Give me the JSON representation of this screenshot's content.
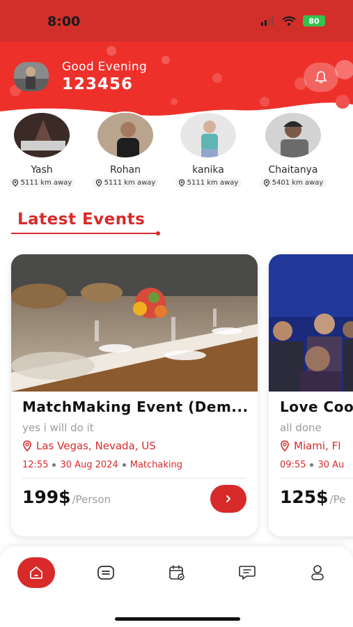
{
  "status_bar": {
    "time": "8:00",
    "battery": "80"
  },
  "header": {
    "greeting": "Good Evening",
    "username": "123456"
  },
  "nearby_people": [
    {
      "name": "Yash",
      "distance": "5111 km away"
    },
    {
      "name": "Rohan",
      "distance": "5111 km away"
    },
    {
      "name": "kanika",
      "distance": "5111 km away"
    },
    {
      "name": "Chaitanya",
      "distance": "5401 km away"
    }
  ],
  "section": {
    "title": "Latest Events"
  },
  "events": [
    {
      "title": "MatchMaking Event (Dem...",
      "subtitle": "yes i will do it",
      "location": "Las Vegas, Nevada, US",
      "time": "12:55",
      "date": "30 Aug 2024",
      "category": "Matchaking",
      "price": "199$",
      "price_unit": "/Person"
    },
    {
      "title": "Love Coo",
      "subtitle": "all done",
      "location": "Miami, Fl",
      "time": "09:55",
      "date": "30 Au",
      "price": "125$",
      "price_unit": "/Pe"
    }
  ],
  "nav": {
    "active": "home"
  },
  "colors": {
    "brand": "#d82a2a",
    "header_bg": "#f0332e"
  }
}
